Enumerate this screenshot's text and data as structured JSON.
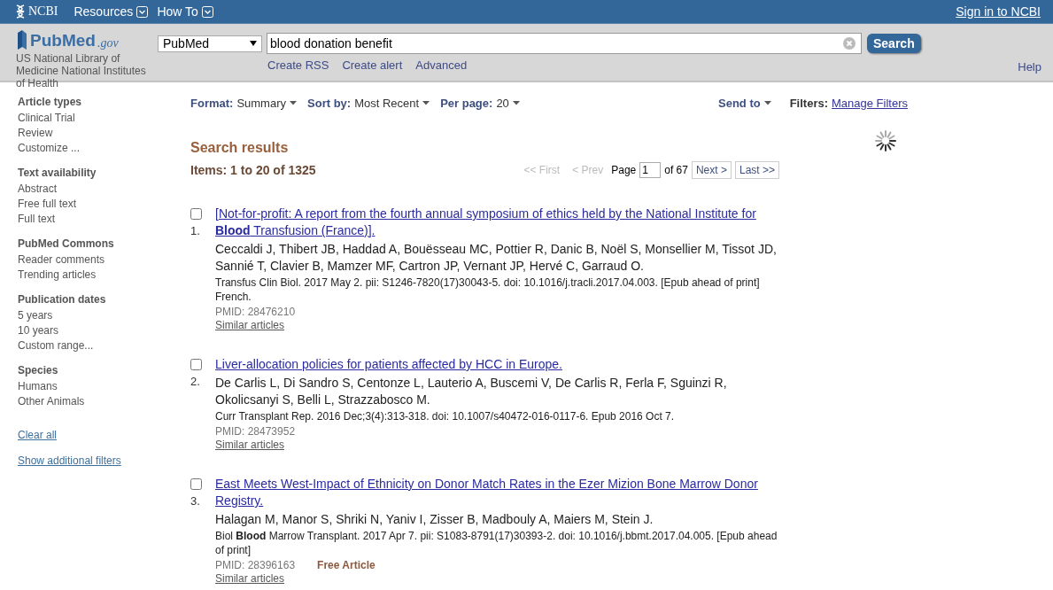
{
  "topbar": {
    "brand": "NCBI",
    "menus": [
      {
        "label": "Resources"
      },
      {
        "label": "How To"
      }
    ],
    "signin": "Sign in to NCBI"
  },
  "header": {
    "logo": "PubMed",
    "logo_suffix": ".gov",
    "library": "US National Library of Medicine National Institutes of Health",
    "database": "PubMed",
    "query": "blood donation benefit",
    "search_button": "Search",
    "links": [
      "Create RSS",
      "Create alert",
      "Advanced"
    ],
    "help": "Help"
  },
  "sidebar": {
    "groups": [
      {
        "heading": "Article types",
        "items": [
          "Clinical Trial",
          "Review",
          "Customize ..."
        ]
      },
      {
        "heading": "Text availability",
        "items": [
          "Abstract",
          "Free full text",
          "Full text"
        ]
      },
      {
        "heading": "PubMed Commons",
        "items": [
          "Reader comments",
          "Trending articles"
        ]
      },
      {
        "heading": "Publication dates",
        "items": [
          "5 years",
          "10 years",
          "Custom range..."
        ]
      },
      {
        "heading": "Species",
        "items": [
          "Humans",
          "Other Animals"
        ]
      }
    ],
    "links": [
      "Clear all",
      "Show additional filters"
    ]
  },
  "toolbar": {
    "options": [
      {
        "label": "Format:",
        "value": "Summary"
      },
      {
        "label": "Sort by:",
        "value": "Most Recent"
      },
      {
        "label": "Per page:",
        "value": "20"
      }
    ],
    "send_to": "Send to",
    "filters_label": "Filters:",
    "filters_link": "Manage Filters"
  },
  "results": {
    "heading": "Search results",
    "count": "Items: 1 to 20 of 1325",
    "pager": {
      "buttons": [
        {
          "label": "<< First",
          "disabled": true
        },
        {
          "label": "< Prev",
          "disabled": true
        },
        {
          "label": "Next >",
          "disabled": false
        },
        {
          "label": "Last >>",
          "disabled": false
        }
      ],
      "page_label": "Page",
      "page": "1",
      "of_pages": "of 67"
    },
    "items": [
      {
        "checked": false,
        "number": "1.",
        "title": "[Not-for-profit: A report from the fourth annual symposium of ethics held by the National Institute for **Blood** Transfusion (France)].",
        "authors": "Ceccaldi J, Thibert JB, Haddad A, Bouësseau MC, Pottier R, Danic B, Noël S, Monsellier M, Tissot JD, Sannié T, Clavier B, Mamzer MF, Cartron JP, Vernant JP, Hervé C, Garraud O.",
        "citation": "Transfus Clin Biol. 2017 May 2. pii: S1246-7820(17)30043-5. doi: 10.1016/j.tracli.2017.04.003. [Epub ahead of print] French.",
        "pmid": "PMID: 28476210",
        "similar": "Similar articles"
      },
      {
        "checked": false,
        "number": "2.",
        "title": "Liver-allocation policies for patients affected by HCC in Europe.",
        "authors": "De Carlis L, Di Sandro S, Centonze L, Lauterio A, Buscemi V, De Carlis R, Ferla F, Sguinzi R, Okolicsanyi S, Belli L, Strazzabosco M.",
        "citation": "Curr Transplant Rep. 2016 Dec;3(4):313-318. doi: 10.1007/s40472-016-0117-6. Epub 2016 Oct 7.",
        "pmid": "PMID: 28473952",
        "similar": "Similar articles"
      },
      {
        "checked": false,
        "number": "3.",
        "title": "East Meets West-Impact of Ethnicity on Donor Match Rates in the Ezer Mizion Bone Marrow Donor Registry.",
        "authors": "Halagan M, Manor S, Shriki N, Yaniv I, Zisser B, Madbouly A, Maiers M, Stein J.",
        "citation": "Biol **Blood** Marrow Transplant. 2017 Apr 7. pii: S1083-8791(17)30393-2. doi: 10.1016/j.bbmt.2017.04.005. [Epub ahead of print]",
        "pmid": "PMID: 28396163",
        "badge": "Free Article",
        "similar": "Similar articles"
      }
    ]
  }
}
